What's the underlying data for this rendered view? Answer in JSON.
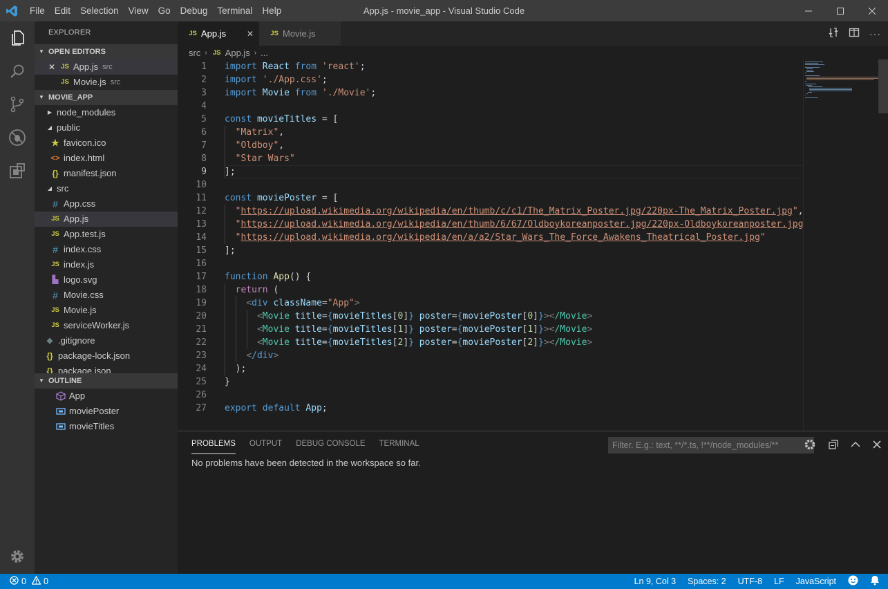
{
  "window": {
    "title": "App.js - movie_app - Visual Studio Code",
    "menu": [
      "File",
      "Edit",
      "Selection",
      "View",
      "Go",
      "Debug",
      "Terminal",
      "Help"
    ]
  },
  "activity": [
    "explorer-icon",
    "search-icon",
    "source-control-icon",
    "debug-icon",
    "extensions-icon",
    "settings-gear-icon"
  ],
  "sidebar": {
    "title": "EXPLORER",
    "open_editors": {
      "label": "OPEN EDITORS",
      "items": [
        {
          "name": "App.js",
          "dir": "src",
          "close": "✕"
        },
        {
          "name": "Movie.js",
          "dir": "src"
        }
      ]
    },
    "project": {
      "label": "MOVIE_APP",
      "items": [
        {
          "name": "node_modules",
          "type": "folder-collapsed"
        },
        {
          "name": "public",
          "type": "folder-open"
        },
        {
          "name": "favicon.ico",
          "type": "star"
        },
        {
          "name": "index.html",
          "type": "html"
        },
        {
          "name": "manifest.json",
          "type": "json"
        },
        {
          "name": "src",
          "type": "folder-open"
        },
        {
          "name": "App.css",
          "type": "css"
        },
        {
          "name": "App.js",
          "type": "js"
        },
        {
          "name": "App.test.js",
          "type": "js"
        },
        {
          "name": "index.css",
          "type": "css"
        },
        {
          "name": "index.js",
          "type": "js"
        },
        {
          "name": "logo.svg",
          "type": "svg"
        },
        {
          "name": "Movie.css",
          "type": "css"
        },
        {
          "name": "Movie.js",
          "type": "js"
        },
        {
          "name": "serviceWorker.js",
          "type": "js"
        },
        {
          "name": ".gitignore",
          "type": "git"
        },
        {
          "name": "package-lock.json",
          "type": "json"
        },
        {
          "name": "package.json",
          "type": "json"
        }
      ]
    },
    "outline": {
      "label": "OUTLINE",
      "items": [
        "App",
        "moviePoster",
        "movieTitles"
      ]
    }
  },
  "tabs": [
    {
      "label": "App.js",
      "icon": "JS",
      "close": "✕"
    },
    {
      "label": "Movie.js",
      "icon": "JS"
    }
  ],
  "breadcrumb": {
    "folder": "src",
    "icon": "JS",
    "file": "App.js",
    "more": "..."
  },
  "editor": {
    "cursor_line": 9,
    "lines": [
      "import React from 'react';",
      "import './App.css';",
      "import Movie from './Movie';",
      "",
      "const movieTitles = [",
      "  \"Matrix\",",
      "  \"Oldboy\",",
      "  \"Star Wars\"",
      "];",
      "",
      "const moviePoster = [",
      "  \"https://upload.wikimedia.org/wikipedia/en/thumb/c/c1/The_Matrix_Poster.jpg/220px-The_Matrix_Poster.jpg\",",
      "  \"https://upload.wikimedia.org/wikipedia/en/thumb/6/67/Oldboykoreanposter.jpg/220px-Oldboykoreanposter.jpg\",",
      "  \"https://upload.wikimedia.org/wikipedia/en/a/a2/Star_Wars_The_Force_Awakens_Theatrical_Poster.jpg\"",
      "];",
      "",
      "function App() {",
      "  return (",
      "    <div className=\"App\">",
      "      <Movie title={movieTitles[0]} poster={moviePoster[0]}></Movie>",
      "      <Movie title={movieTitles[1]} poster={moviePoster[1]}></Movie>",
      "      <Movie title={movieTitles[2]} poster={moviePoster[2]}></Movie>",
      "    </div>",
      "  );",
      "}",
      "",
      "export default App;"
    ]
  },
  "panel": {
    "tabs": [
      "PROBLEMS",
      "OUTPUT",
      "DEBUG CONSOLE",
      "TERMINAL"
    ],
    "active_tab": "PROBLEMS",
    "filter_placeholder": "Filter. E.g.: text, **/*.ts, !**/node_modules/**",
    "message": "No problems have been detected in the workspace so far."
  },
  "status": {
    "errors": "0",
    "warnings": "0",
    "position": "Ln 9, Col 3",
    "spaces": "Spaces: 2",
    "encoding": "UTF-8",
    "eol": "LF",
    "language": "JavaScript"
  },
  "colors": {
    "status_bar": "#007acc",
    "activity_bar": "#333333",
    "sidebar": "#252526",
    "editor": "#1e1e1e",
    "keyword": "#569cd6",
    "string": "#ce9178"
  }
}
